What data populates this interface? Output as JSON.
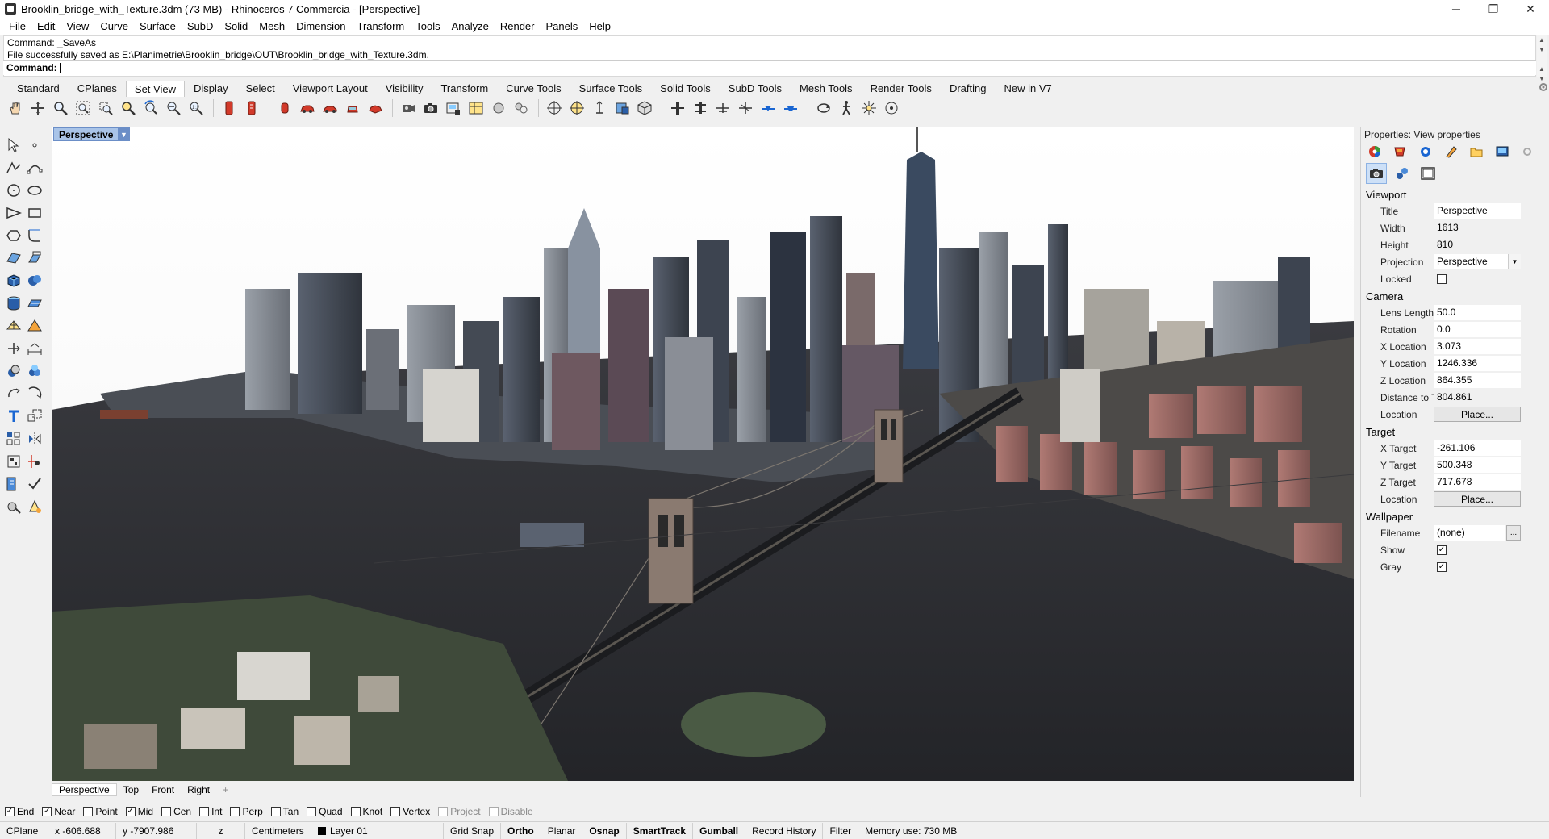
{
  "window": {
    "title": "Brooklin_bridge_with_Texture.3dm (73 MB) - Rhinoceros 7 Commercia - [Perspective]",
    "minimize": "─",
    "restore": "❐",
    "close": "✕"
  },
  "menu": [
    "File",
    "Edit",
    "View",
    "Curve",
    "Surface",
    "SubD",
    "Solid",
    "Mesh",
    "Dimension",
    "Transform",
    "Tools",
    "Analyze",
    "Render",
    "Panels",
    "Help"
  ],
  "command": {
    "history": [
      "Command: _SaveAs",
      "File successfully saved as E:\\Planimetrie\\Brooklin_bridge\\OUT\\Brooklin_bridge_with_Texture.3dm."
    ],
    "prompt": "Command:"
  },
  "toolbar_tabs": [
    "Standard",
    "CPlanes",
    "Set View",
    "Display",
    "Select",
    "Viewport Layout",
    "Visibility",
    "Transform",
    "Curve Tools",
    "Surface Tools",
    "Solid Tools",
    "SubD Tools",
    "Mesh Tools",
    "Render Tools",
    "Drafting",
    "New in V7"
  ],
  "active_tab": "Set View",
  "viewport": {
    "name": "Perspective",
    "tabs": [
      "Perspective",
      "Top",
      "Front",
      "Right"
    ],
    "add": "+"
  },
  "osnaps": [
    {
      "label": "End",
      "checked": true,
      "enabled": true
    },
    {
      "label": "Near",
      "checked": true,
      "enabled": true
    },
    {
      "label": "Point",
      "checked": false,
      "enabled": true
    },
    {
      "label": "Mid",
      "checked": true,
      "enabled": true
    },
    {
      "label": "Cen",
      "checked": false,
      "enabled": true
    },
    {
      "label": "Int",
      "checked": false,
      "enabled": true
    },
    {
      "label": "Perp",
      "checked": false,
      "enabled": true
    },
    {
      "label": "Tan",
      "checked": false,
      "enabled": true
    },
    {
      "label": "Quad",
      "checked": false,
      "enabled": true
    },
    {
      "label": "Knot",
      "checked": false,
      "enabled": true
    },
    {
      "label": "Vertex",
      "checked": false,
      "enabled": true
    },
    {
      "label": "Project",
      "checked": false,
      "enabled": false
    },
    {
      "label": "Disable",
      "checked": false,
      "enabled": false
    }
  ],
  "status": {
    "cplane": "CPlane",
    "x": "x -606.688",
    "y": "y -7907.986",
    "z": "z",
    "units": "Centimeters",
    "layer": "Layer 01",
    "grid_snap": "Grid Snap",
    "ortho": "Ortho",
    "planar": "Planar",
    "osnap": "Osnap",
    "smarttrack": "SmartTrack",
    "gumball": "Gumball",
    "record_history": "Record History",
    "filter": "Filter",
    "memory": "Memory use: 730 MB"
  },
  "properties": {
    "header": "Properties: View properties",
    "viewport_section": "Viewport",
    "camera_section": "Camera",
    "target_section": "Target",
    "wallpaper_section": "Wallpaper",
    "viewport": [
      {
        "k": "Title",
        "v": "Perspective"
      },
      {
        "k": "Width",
        "v": "1613"
      },
      {
        "k": "Height",
        "v": "810"
      },
      {
        "k": "Projection",
        "v": "Perspective"
      }
    ],
    "locked_label": "Locked",
    "camera": [
      {
        "k": "Lens Length",
        "v": "50.0"
      },
      {
        "k": "Rotation",
        "v": "0.0"
      },
      {
        "k": "X Location",
        "v": "3.073"
      },
      {
        "k": "Y Location",
        "v": "1246.336"
      },
      {
        "k": "Z Location",
        "v": "864.355"
      },
      {
        "k": "Distance to Ta...",
        "v": "804.861"
      }
    ],
    "location_label": "Location",
    "place_button": "Place...",
    "target": [
      {
        "k": "X Target",
        "v": "-261.106"
      },
      {
        "k": "Y Target",
        "v": "500.348"
      },
      {
        "k": "Z Target",
        "v": "717.678"
      }
    ],
    "filename_label": "Filename",
    "filename_value": "(none)",
    "browse": "...",
    "show_label": "Show",
    "gray_label": "Gray"
  }
}
